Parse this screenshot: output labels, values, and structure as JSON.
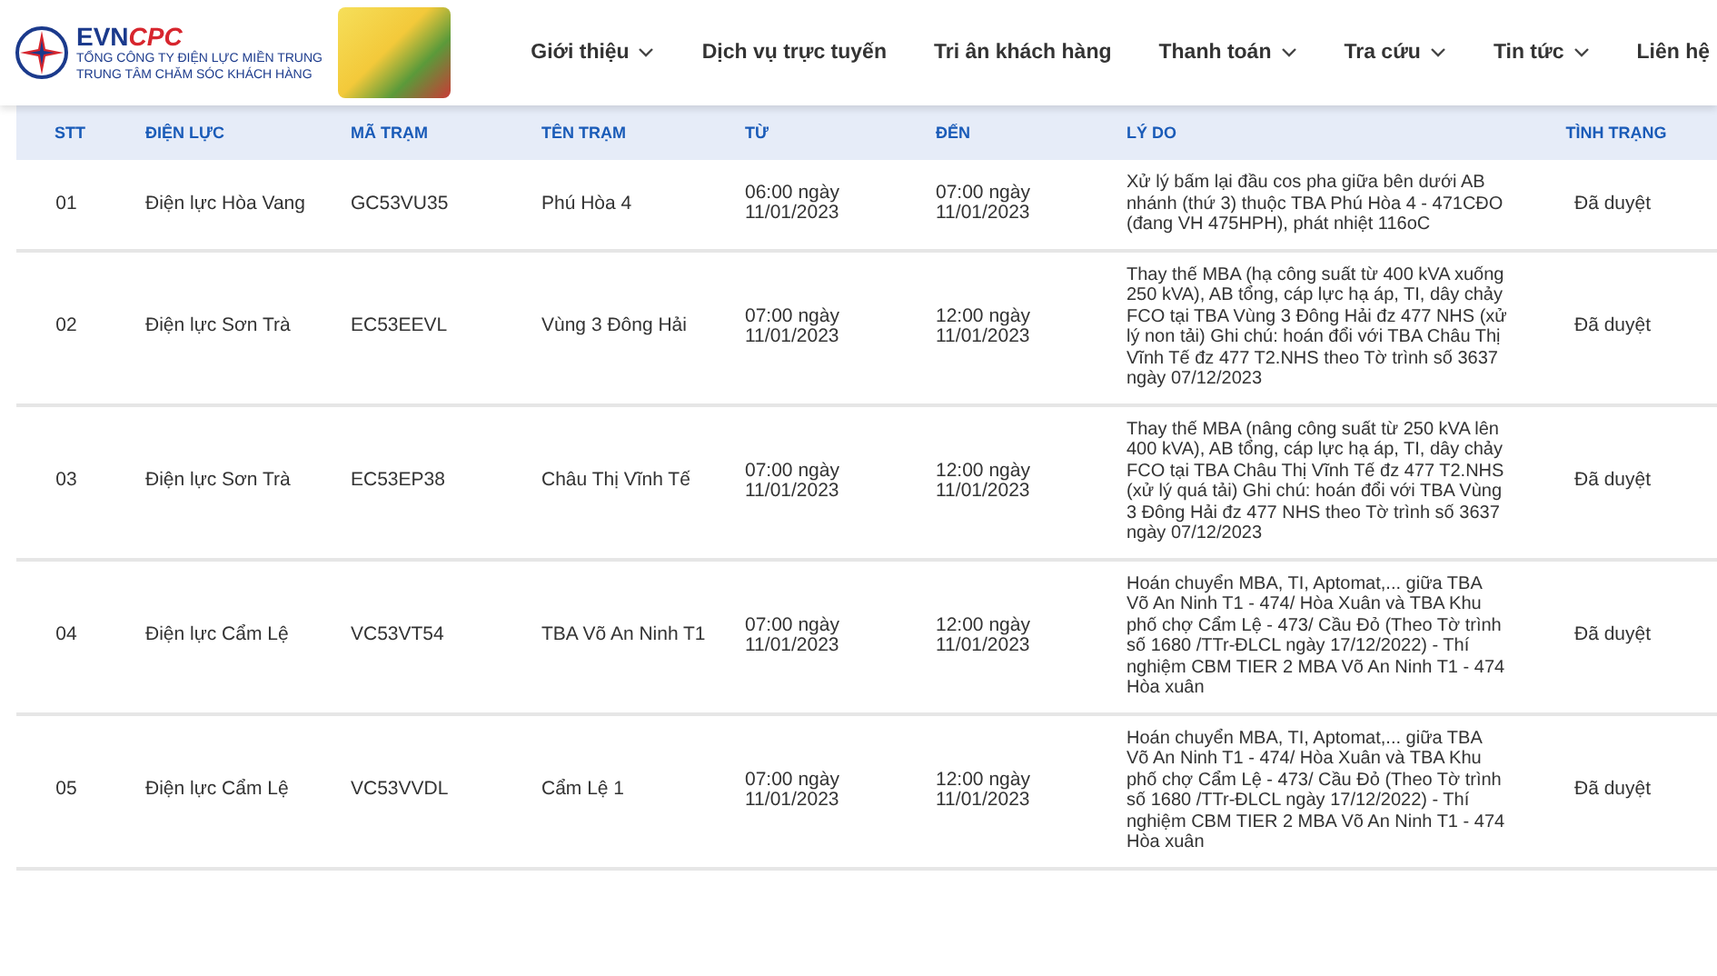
{
  "header": {
    "brand": {
      "part_1": "EVN",
      "part_2": "CPC"
    },
    "company": "TỔNG CÔNG TY ĐIỆN LỰC MIỀN TRUNG",
    "center": "TRUNG TÂM CHĂM SÓC KHÁCH HÀNG",
    "nav": [
      {
        "label": "Giới thiệu",
        "has_menu": true
      },
      {
        "label": "Dịch vụ trực tuyến",
        "has_menu": false
      },
      {
        "label": "Tri ân khách hàng",
        "has_menu": false
      },
      {
        "label": "Thanh toán",
        "has_menu": true
      },
      {
        "label": "Tra cứu",
        "has_menu": true
      },
      {
        "label": "Tin tức",
        "has_menu": true
      },
      {
        "label": "Liên hệ",
        "has_menu": false
      }
    ]
  },
  "table": {
    "columns": [
      "STT",
      "ĐIỆN LỰC",
      "MÃ TRẠM",
      "TÊN TRẠM",
      "TỪ",
      "ĐẾN",
      "LÝ DO",
      "TÌNH TRẠNG"
    ],
    "rows": [
      [
        "01",
        "Điện lực Hòa Vang",
        "GC53VU35",
        "Phú Hòa 4",
        "06:00 ngày 11/01/2023",
        "07:00 ngày 11/01/2023",
        "Xử lý bấm lại đầu cos pha giữa bên dưới AB nhánh (thứ 3) thuộc TBA Phú Hòa 4 - 471CĐO (đang VH 475HPH), phát nhiệt 116oC",
        "Đã duyệt"
      ],
      [
        "02",
        "Điện lực Sơn Trà",
        "EC53EEVL",
        "Vùng 3 Đông Hải",
        "07:00 ngày 11/01/2023",
        "12:00 ngày 11/01/2023",
        "Thay thế MBA (hạ công suất từ 400 kVA xuống 250 kVA), AB tổng, cáp lực hạ áp, TI, dây chảy FCO tại TBA Vùng 3 Đông Hải đz 477 NHS (xử lý non tải) Ghi chú: hoán đổi với TBA Châu Thị Vĩnh Tế đz 477 T2.NHS theo Tờ trình số 3637 ngày 07/12/2023",
        "Đã duyệt"
      ],
      [
        "03",
        "Điện lực Sơn Trà",
        "EC53EP38",
        "Châu Thị Vĩnh Tế",
        "07:00 ngày 11/01/2023",
        "12:00 ngày 11/01/2023",
        "Thay thế MBA (nâng công suất từ 250 kVA lên 400 kVA), AB tổng, cáp lực hạ áp, TI, dây chảy FCO tại TBA Châu Thị Vĩnh Tế đz 477 T2.NHS (xử lý quá tải) Ghi chú: hoán đổi với TBA Vùng 3 Đông Hải đz 477 NHS theo Tờ trình số 3637 ngày 07/12/2023",
        "Đã duyệt"
      ],
      [
        "04",
        "Điện lực Cẩm Lệ",
        "VC53VT54",
        "TBA Võ An Ninh T1",
        "07:00 ngày 11/01/2023",
        "12:00 ngày 11/01/2023",
        "Hoán chuyển MBA, TI, Aptomat,... giữa TBA Võ An Ninh T1 - 474/ Hòa Xuân và TBA Khu phố chợ Cẩm Lệ - 473/ Cầu Đỏ (Theo Tờ trình số 1680 /TTr-ĐLCL ngày 17/12/2022) - Thí nghiệm CBM TIER 2 MBA Võ An Ninh T1 - 474 Hòa xuân",
        "Đã duyệt"
      ],
      [
        "05",
        "Điện lực Cẩm Lệ",
        "VC53VVDL",
        "Cẩm Lệ 1",
        "07:00 ngày 11/01/2023",
        "12:00 ngày 11/01/2023",
        "Hoán chuyển MBA, TI, Aptomat,... giữa TBA Võ An Ninh T1 - 474/ Hòa Xuân và TBA Khu phố chợ Cẩm Lệ - 473/ Cầu Đỏ (Theo Tờ trình số 1680 /TTr-ĐLCL ngày 17/12/2022) - Thí nghiệm CBM TIER 2 MBA Võ An Ninh T1 - 474 Hòa xuân",
        "Đã duyệt"
      ]
    ]
  }
}
